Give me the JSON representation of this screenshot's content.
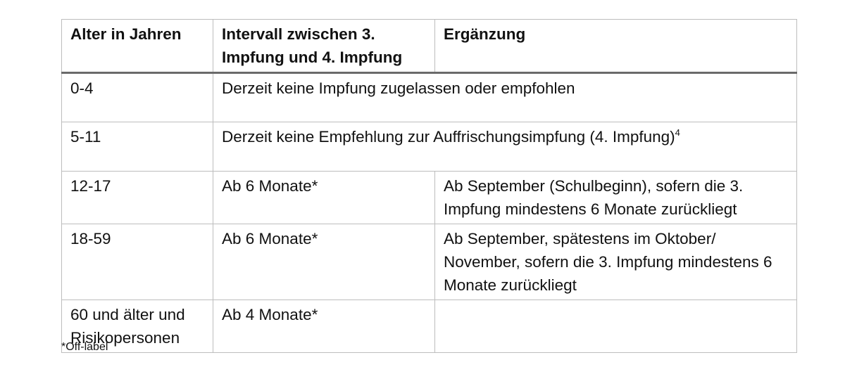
{
  "table": {
    "headers": [
      "Alter in Jahren",
      "Intervall zwischen 3. Impfung und 4. Impfung",
      "Ergänzung"
    ],
    "rows": [
      {
        "age": "0-4",
        "merged_text": "Derzeit keine Impfung zugelassen oder empfohlen"
      },
      {
        "age": "5-11",
        "merged_text": "Derzeit keine Empfehlung zur Auffrischungsimpfung (4. Impfung)",
        "footnote_ref": "4"
      },
      {
        "age": "12-17",
        "interval": "Ab 6 Monate*",
        "note": "Ab September (Schulbeginn), sofern die 3. Impfung mindestens 6 Monate zurückliegt"
      },
      {
        "age": "18-59",
        "interval": "Ab 6 Monate*",
        "note": "Ab September, spätestens im Oktober/ November, sofern die 3. Impfung mindestens 6 Monate zurückliegt"
      },
      {
        "age": "60 und älter und Risikopersonen",
        "interval": "Ab 4 Monate*",
        "note": ""
      }
    ]
  },
  "footnote": "*Off-label"
}
